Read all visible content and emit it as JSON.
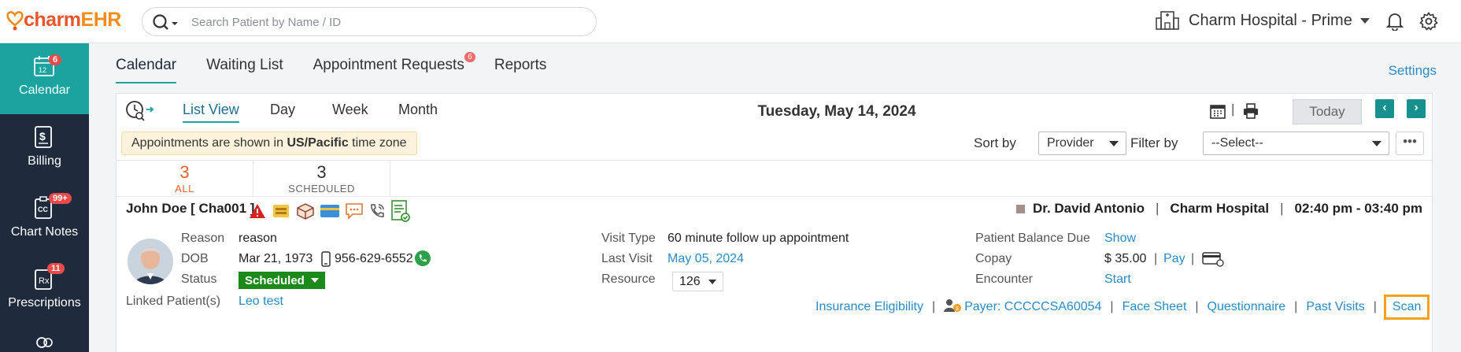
{
  "brand": {
    "logo_part1": "charm",
    "logo_part2": "EHR"
  },
  "search": {
    "placeholder": "Search Patient by Name / ID"
  },
  "facility": {
    "name": "Charm Hospital - Prime"
  },
  "sidebar": {
    "items": [
      {
        "label": "Calendar",
        "badge": "6",
        "icon": "calendar-icon"
      },
      {
        "label": "Billing",
        "icon": "billing-icon"
      },
      {
        "label": "Chart Notes",
        "badge": "99+",
        "icon": "chart-notes-icon"
      },
      {
        "label": "Prescriptions",
        "badge": "11",
        "icon": "prescription-icon"
      }
    ]
  },
  "tabs": [
    {
      "label": "Calendar"
    },
    {
      "label": "Waiting List"
    },
    {
      "label": "Appointment Requests",
      "badge": "6"
    },
    {
      "label": "Reports"
    }
  ],
  "settings_link": "Settings",
  "view": {
    "tabs": [
      "List View",
      "Day",
      "Week",
      "Month"
    ],
    "active": "List View",
    "date": "Tuesday, May 14, 2024",
    "today_label": "Today",
    "separator": "|"
  },
  "timezone_notice": {
    "prefix": "Appointments are shown in ",
    "zone": "US/Pacific",
    "suffix": " time zone"
  },
  "sort": {
    "label": "Sort by",
    "value": "Provider"
  },
  "filter": {
    "label": "Filter by",
    "value": "--Select--"
  },
  "counters": [
    {
      "count": "3",
      "label": "ALL"
    },
    {
      "count": "3",
      "label": "SCHEDULED"
    }
  ],
  "appointment": {
    "patient": "John Doe  [ Cha001 ]",
    "provider": "Dr. David Antonio",
    "facility": "Charm Hospital",
    "time": "02:40 pm - 03:40 pm",
    "sep": "|",
    "reason_label": "Reason",
    "reason": "reason",
    "dob_label": "DOB",
    "dob": "Mar 21, 1973",
    "phone": "956-629-6552",
    "status_label": "Status",
    "status": "Scheduled",
    "linked_label": "Linked Patient(s)",
    "linked": "Leo test",
    "visit_type_label": "Visit Type",
    "visit_type": "60 minute follow up appointment",
    "last_visit_label": "Last Visit",
    "last_visit": "May 05, 2024",
    "resource_label": "Resource",
    "resource": "126",
    "balance_label": "Patient Balance Due",
    "balance_link": "Show",
    "copay_label": "Copay",
    "copay": "$ 35.00",
    "pay_link": "Pay",
    "encounter_label": "Encounter",
    "encounter_link": "Start"
  },
  "bottom_links": {
    "insurance": "Insurance Eligibility",
    "payer": "Payer: CCCCCSA60054",
    "face_sheet": "Face Sheet",
    "questionnaire": "Questionnaire",
    "past_visits": "Past Visits",
    "scan": "Scan",
    "sep": "|"
  },
  "colors": {
    "accent": "#1aa39f",
    "sidebar": "#1f2b3d",
    "link": "#2a8ac4",
    "status": "#1b8a1b",
    "scan_highlight": "#f5a21b"
  }
}
